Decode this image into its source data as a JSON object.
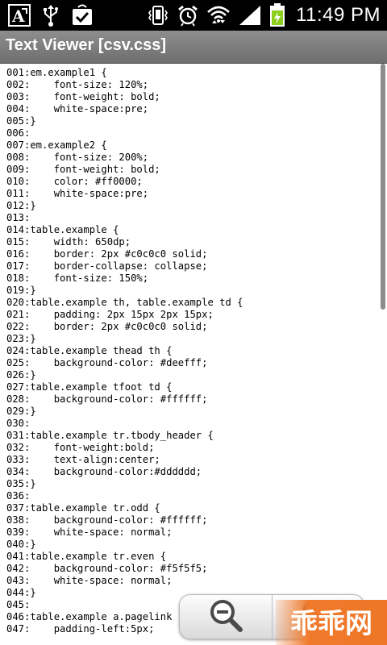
{
  "status_bar": {
    "time": "11:49 PM",
    "icons": [
      "text-format-notification-icon",
      "usb-icon",
      "download-complete-icon",
      "vibrate-icon",
      "alarm-icon",
      "wifi-icon",
      "cell-signal-icon",
      "battery-charging-icon"
    ]
  },
  "title_bar": {
    "title": "Text Viewer [csv.css]"
  },
  "code_lines": [
    "001:em.example1 {",
    "002:    font-size: 120%;",
    "003:    font-weight: bold;",
    "004:    white-space:pre;",
    "005:}",
    "006:",
    "007:em.example2 {",
    "008:    font-size: 200%;",
    "009:    font-weight: bold;",
    "010:    color: #ff0000;",
    "011:    white-space:pre;",
    "012:}",
    "013:",
    "014:table.example {",
    "015:    width: 650dp;",
    "016:    border: 2px #c0c0c0 solid;",
    "017:    border-collapse: collapse;",
    "018:    font-size: 150%;",
    "019:}",
    "020:table.example th, table.example td {",
    "021:    padding: 2px 15px 2px 15px;",
    "022:    border: 2px #c0c0c0 solid;",
    "023:}",
    "024:table.example thead th {",
    "025:    background-color: #deefff;",
    "026:}",
    "027:table.example tfoot td {",
    "028:    background-color: #ffffff;",
    "029:}",
    "030:",
    "031:table.example tr.tbody_header {",
    "032:    font-weight:bold;",
    "033:    text-align:center;",
    "034:    background-color:#dddddd;",
    "035:}",
    "036:",
    "037:table.example tr.odd {",
    "038:    background-color: #ffffff;",
    "039:    white-space: normal;",
    "040:}",
    "041:table.example tr.even {",
    "042:    background-color: #f5f5f5;",
    "043:    white-space: normal;",
    "044:}",
    "045:",
    "046:table.example a.pagelink",
    "047:    padding-left:5px;"
  ],
  "zoom_controls": {
    "zoom_out_icon": "zoom-out-icon",
    "zoom_in_icon": "zoom-in-icon"
  },
  "watermark": {
    "text": "乖乖网",
    "color": "#f07a2c"
  },
  "colors": {
    "status_bar": "#000000",
    "title_bar": "#7e7e7e",
    "background": "#ffffff",
    "text": "#000000"
  }
}
